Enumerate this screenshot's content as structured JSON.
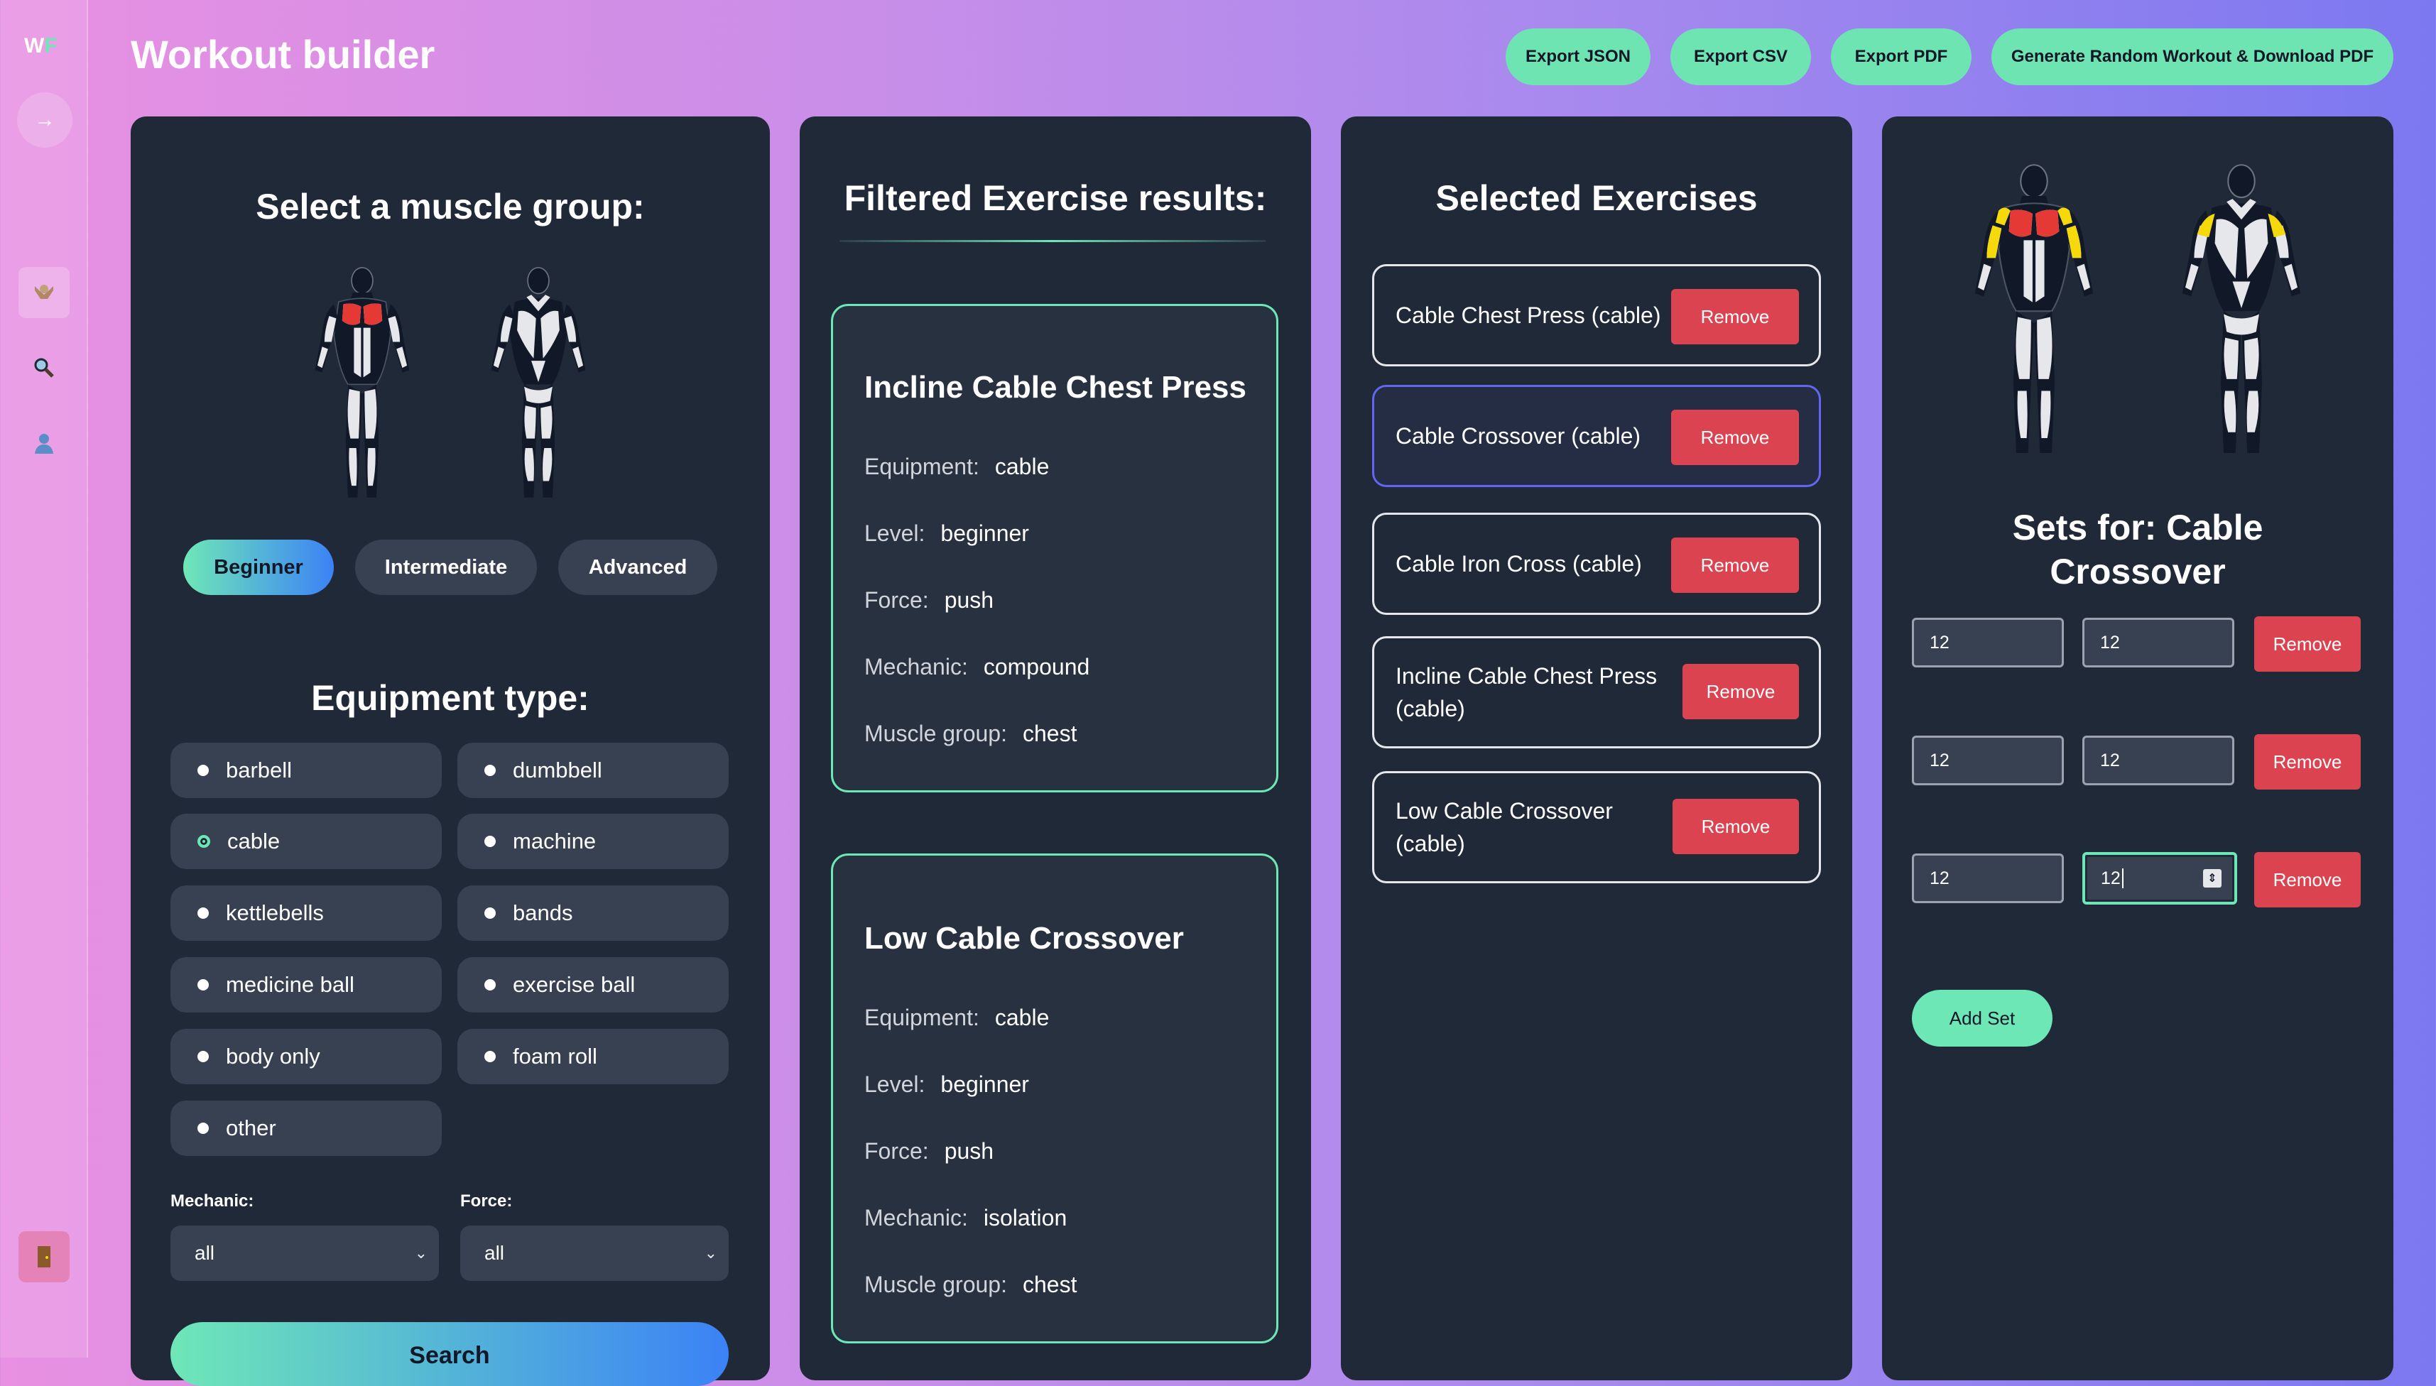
{
  "sidebar": {
    "logo_w": "W",
    "logo_f": "F",
    "icons": [
      "arrow-right-icon",
      "muscle-icon",
      "search-icon",
      "user-icon",
      "door-icon"
    ]
  },
  "header": {
    "title": "Workout builder",
    "buttons": [
      "Export JSON",
      "Export CSV",
      "Export PDF",
      "Generate Random Workout & Download PDF"
    ]
  },
  "muscle_panel": {
    "title": "Select a muscle group:",
    "levels": [
      "Beginner",
      "Intermediate",
      "Advanced"
    ],
    "active_level": "Beginner",
    "equipment_title": "Equipment type:",
    "equipment": [
      "barbell",
      "dumbbell",
      "cable",
      "machine",
      "kettlebells",
      "bands",
      "medicine ball",
      "exercise ball",
      "body only",
      "foam roll",
      "other"
    ],
    "selected_equipment": "cable",
    "mechanic_label": "Mechanic:",
    "mechanic_value": "all",
    "force_label": "Force:",
    "force_value": "all",
    "search_label": "Search"
  },
  "results": {
    "title": "Filtered Exercise results:",
    "keys": [
      "Equipment:",
      "Level:",
      "Force:",
      "Mechanic:",
      "Muscle group:"
    ],
    "items": [
      {
        "name": "Incline Cable Chest Press",
        "equipment": "cable",
        "level": "beginner",
        "force": "push",
        "mechanic": "compound",
        "muscle": "chest"
      },
      {
        "name": "Low Cable Crossover",
        "equipment": "cable",
        "level": "beginner",
        "force": "push",
        "mechanic": "isolation",
        "muscle": "chest"
      }
    ]
  },
  "selected": {
    "title": "Selected Exercises",
    "remove_label": "Remove",
    "items": [
      {
        "name": "Cable Chest Press (cable)"
      },
      {
        "name": "Cable Crossover (cable)"
      },
      {
        "name": "Cable Iron Cross (cable)"
      },
      {
        "name_l1": "Incline Cable Chest Press",
        "name_l2": "(cable)"
      },
      {
        "name_l1": "Low Cable Crossover",
        "name_l2": "(cable)"
      }
    ],
    "active_index": 1
  },
  "sets": {
    "title_l1": "Sets for: Cable",
    "title_l2": "Crossover",
    "rows": [
      [
        "12",
        "12"
      ],
      [
        "12",
        "12"
      ],
      [
        "12",
        "12"
      ]
    ],
    "remove_label": "Remove",
    "add_label": "Add Set"
  },
  "colors": {
    "accent": "#6ee7b7",
    "danger": "#dc4350",
    "panel": "#1f2937",
    "chest_highlight": "#e53935",
    "shoulder_highlight": "#f5d90a"
  }
}
